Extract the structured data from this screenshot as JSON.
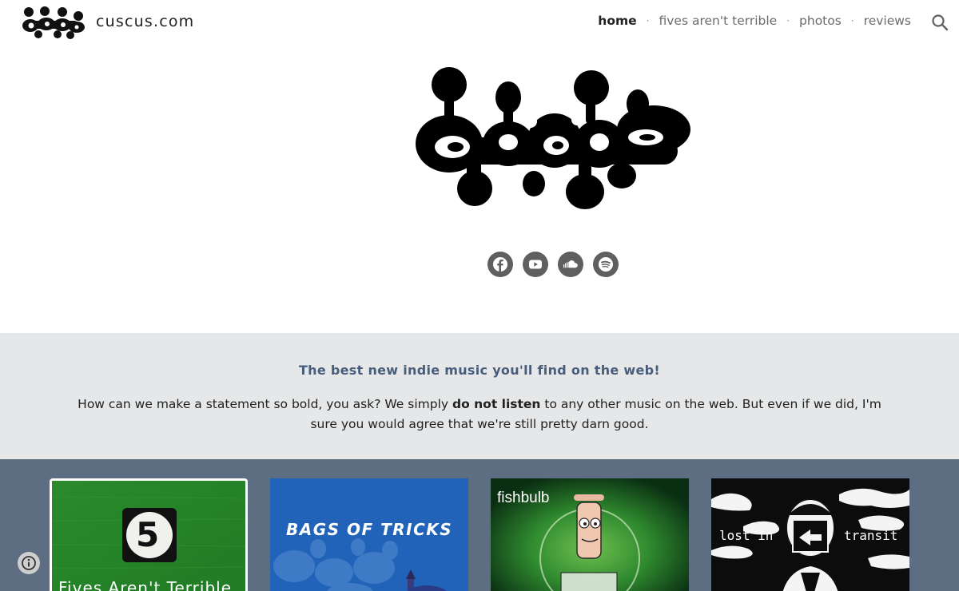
{
  "header": {
    "site_name": "cuscus.com",
    "logo_icon": "blob-logo-icon",
    "nav": [
      {
        "label": "home",
        "active": true
      },
      {
        "label": "fives aren't terrible",
        "active": false
      },
      {
        "label": "photos",
        "active": false
      },
      {
        "label": "reviews",
        "active": false
      }
    ],
    "nav_separator": "·",
    "search_icon": "search-icon"
  },
  "hero": {
    "logo_icon": "blob-logo-icon",
    "social": [
      {
        "name": "facebook-icon"
      },
      {
        "name": "youtube-icon"
      },
      {
        "name": "soundcloud-icon"
      },
      {
        "name": "spotify-icon"
      }
    ]
  },
  "intro": {
    "heading": "The best new indie music you'll find on the web!",
    "text_before": "How can we make a statement so bold, you ask?  We simply ",
    "text_bold": "do not listen",
    "text_after": " to any other music on the web. But even if we did, I'm sure you would agree that we're still pretty darn good."
  },
  "albums": [
    {
      "title": "Fives Aren't Terrible",
      "badge": "5"
    },
    {
      "title": "BAGS OF TRICKS"
    },
    {
      "title": "fishbulb"
    },
    {
      "title_left": "lost in",
      "title_right": "transit"
    }
  ],
  "colors": {
    "heading": "#485d7b",
    "band": "#e6e7e8",
    "album_strip": "#5e6e82",
    "social_button": "#5f5f5f"
  },
  "info_icon": "info-icon"
}
